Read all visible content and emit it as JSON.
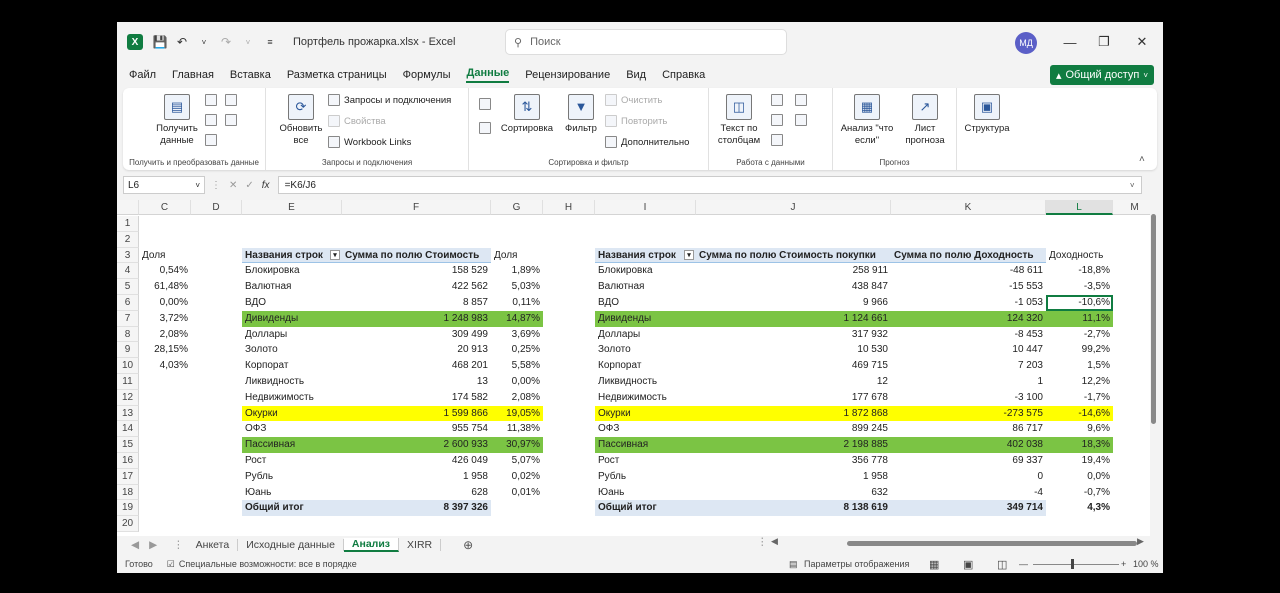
{
  "title": {
    "filename": "Портфель прожарка.xlsx",
    "app": "Excel",
    "separator": "-",
    "search_placeholder": "Поиск",
    "user_initials": "МД"
  },
  "menu": [
    "Файл",
    "Главная",
    "Вставка",
    "Разметка страницы",
    "Формулы",
    "Данные",
    "Рецензирование",
    "Вид",
    "Справка"
  ],
  "active_menu": "Данные",
  "share_label": "Общий доступ",
  "ribbon": {
    "get_data": "Получить данные",
    "group1_label": "Получить и преобразовать данные",
    "refresh_all": "Обновить все",
    "queries_connections": "Запросы и подключения",
    "properties": "Свойства",
    "workbook_links": "Workbook Links",
    "group2_label": "Запросы и подключения",
    "sort": "Сортировка",
    "filter": "Фильтр",
    "clear": "Очистить",
    "reapply": "Повторить",
    "advanced": "Дополнительно",
    "group3_label": "Сортировка и фильтр",
    "text_to_columns": "Текст по столбцам",
    "group4_label": "Работа с данными",
    "what_if": "Анализ \"что если\"",
    "forecast_sheet": "Лист прогноза",
    "group5_label": "Прогноз",
    "outline": "Структура"
  },
  "formula_bar": {
    "cell_ref": "L6",
    "formula": "=K6/J6",
    "fx": "fx"
  },
  "columns": [
    "C",
    "D",
    "E",
    "F",
    "G",
    "H",
    "I",
    "J",
    "K",
    "L",
    "M"
  ],
  "selected_column": "L",
  "rows": [
    "1",
    "2",
    "3",
    "4",
    "5",
    "6",
    "7",
    "8",
    "9",
    "10",
    "11",
    "12",
    "13",
    "14",
    "15",
    "16",
    "17",
    "18",
    "19",
    "20"
  ],
  "table_left": {
    "share_header": "Доля",
    "share_values": [
      "0,54%",
      "61,48%",
      "0,00%",
      "3,72%",
      "2,08%",
      "28,15%",
      "4,03%"
    ],
    "header_row": "Названия строк",
    "header_sum": "Сумма по полю Стоимость",
    "header_share": "Доля",
    "rows": [
      {
        "name": "Блокировка",
        "sum": "158 529",
        "share": "1,89%",
        "hl": ""
      },
      {
        "name": "Валютная",
        "sum": "422 562",
        "share": "5,03%",
        "hl": ""
      },
      {
        "name": "ВДО",
        "sum": "8 857",
        "share": "0,11%",
        "hl": ""
      },
      {
        "name": "Дивиденды",
        "sum": "1 248 983",
        "share": "14,87%",
        "hl": "green"
      },
      {
        "name": "Доллары",
        "sum": "309 499",
        "share": "3,69%",
        "hl": ""
      },
      {
        "name": "Золото",
        "sum": "20 913",
        "share": "0,25%",
        "hl": ""
      },
      {
        "name": "Корпорат",
        "sum": "468 201",
        "share": "5,58%",
        "hl": ""
      },
      {
        "name": "Ликвидность",
        "sum": "13",
        "share": "0,00%",
        "hl": ""
      },
      {
        "name": "Недвижимость",
        "sum": "174 582",
        "share": "2,08%",
        "hl": ""
      },
      {
        "name": "Окурки",
        "sum": "1 599 866",
        "share": "19,05%",
        "hl": "yellow"
      },
      {
        "name": "ОФЗ",
        "sum": "955 754",
        "share": "11,38%",
        "hl": ""
      },
      {
        "name": "Пассивная",
        "sum": "2 600 933",
        "share": "30,97%",
        "hl": "green"
      },
      {
        "name": "Рост",
        "sum": "426 049",
        "share": "5,07%",
        "hl": ""
      },
      {
        "name": "Рубль",
        "sum": "1 958",
        "share": "0,02%",
        "hl": ""
      },
      {
        "name": "Юань",
        "sum": "628",
        "share": "0,01%",
        "hl": ""
      }
    ],
    "total_label": "Общий итог",
    "total_sum": "8 397 326"
  },
  "table_right": {
    "header_row": "Названия строк",
    "header_buy": "Сумма по полю Стоимость покупки",
    "header_yield": "Сумма по полю Доходность",
    "header_pct": "Доходность",
    "rows": [
      {
        "name": "Блокировка",
        "buy": "258 911",
        "yield": "-48 611",
        "pct": "-18,8%",
        "hl": ""
      },
      {
        "name": "Валютная",
        "buy": "438 847",
        "yield": "-15 553",
        "pct": "-3,5%",
        "hl": ""
      },
      {
        "name": "ВДО",
        "buy": "9 966",
        "yield": "-1 053",
        "pct": "-10,6%",
        "hl": ""
      },
      {
        "name": "Дивиденды",
        "buy": "1 124 661",
        "yield": "124 320",
        "pct": "11,1%",
        "hl": "green"
      },
      {
        "name": "Доллары",
        "buy": "317 932",
        "yield": "-8 453",
        "pct": "-2,7%",
        "hl": ""
      },
      {
        "name": "Золото",
        "buy": "10 530",
        "yield": "10 447",
        "pct": "99,2%",
        "hl": ""
      },
      {
        "name": "Корпорат",
        "buy": "469 715",
        "yield": "7 203",
        "pct": "1,5%",
        "hl": ""
      },
      {
        "name": "Ликвидность",
        "buy": "12",
        "yield": "1",
        "pct": "12,2%",
        "hl": ""
      },
      {
        "name": "Недвижимость",
        "buy": "177 678",
        "yield": "-3 100",
        "pct": "-1,7%",
        "hl": ""
      },
      {
        "name": "Окурки",
        "buy": "1 872 868",
        "yield": "-273 575",
        "pct": "-14,6%",
        "hl": "yellow"
      },
      {
        "name": "ОФЗ",
        "buy": "899 245",
        "yield": "86 717",
        "pct": "9,6%",
        "hl": ""
      },
      {
        "name": "Пассивная",
        "buy": "2 198 885",
        "yield": "402 038",
        "pct": "18,3%",
        "hl": "green"
      },
      {
        "name": "Рост",
        "buy": "356 778",
        "yield": "69 337",
        "pct": "19,4%",
        "hl": ""
      },
      {
        "name": "Рубль",
        "buy": "1 958",
        "yield": "0",
        "pct": "0,0%",
        "hl": ""
      },
      {
        "name": "Юань",
        "buy": "632",
        "yield": "-4",
        "pct": "-0,7%",
        "hl": ""
      }
    ],
    "total_label": "Общий итог",
    "total_buy": "8 138 619",
    "total_yield": "349 714",
    "total_pct": "4,3%"
  },
  "sheet_tabs": [
    "Анкета",
    "Исходные данные",
    "Анализ",
    "XIRR"
  ],
  "active_sheet": "Анализ",
  "status": {
    "ready": "Готово",
    "accessibility": "Специальные возможности: все в порядке",
    "display_settings": "Параметры отображения",
    "zoom": "100 %"
  }
}
